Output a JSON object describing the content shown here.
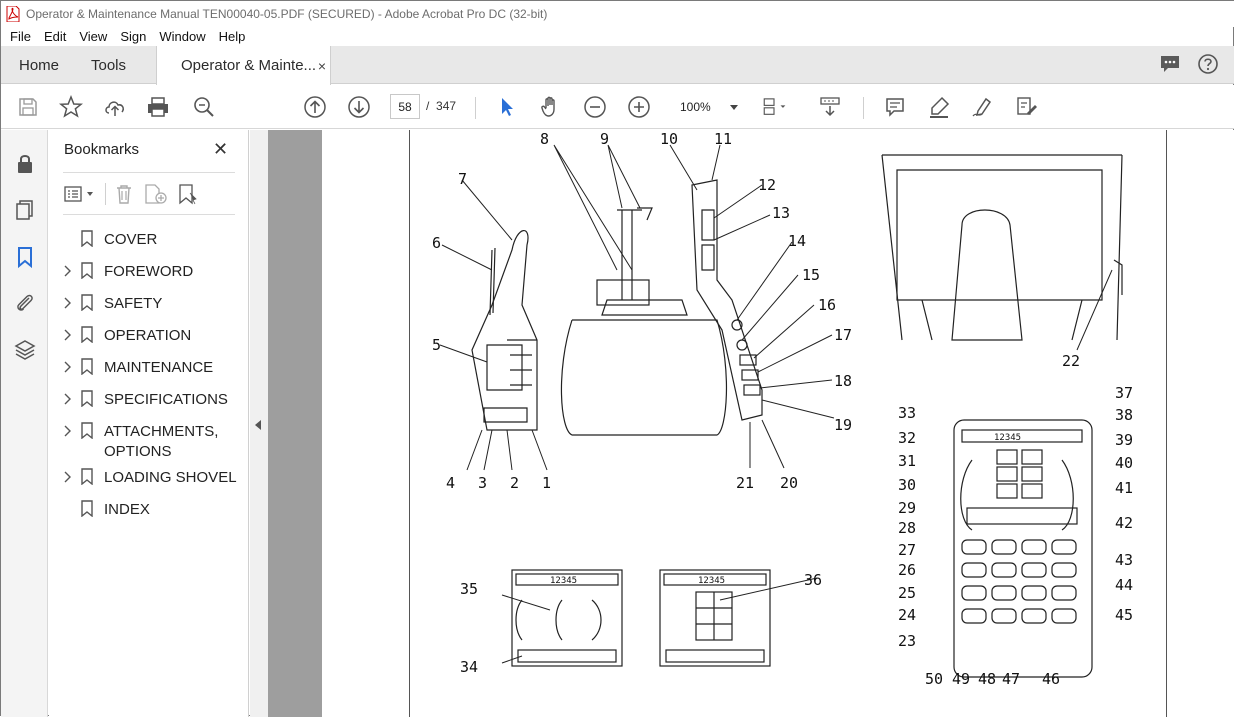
{
  "window": {
    "title": "Operator & Maintenance Manual TEN00040-05.PDF (SECURED) - Adobe Acrobat Pro DC (32-bit)"
  },
  "menu": [
    "File",
    "Edit",
    "View",
    "Sign",
    "Window",
    "Help"
  ],
  "tabs": {
    "home": "Home",
    "tools": "Tools",
    "document": "Operator & Mainte...",
    "close_glyph": "×"
  },
  "toolbar": {
    "page_current": "58",
    "page_sep": "/",
    "page_total": "347",
    "zoom": "100%"
  },
  "bookmarks": {
    "title": "Bookmarks",
    "close_glyph": "✕",
    "items": [
      {
        "label": "COVER",
        "expandable": false
      },
      {
        "label": "FOREWORD",
        "expandable": true
      },
      {
        "label": "SAFETY",
        "expandable": true
      },
      {
        "label": "OPERATION",
        "expandable": true
      },
      {
        "label": "MAINTENANCE",
        "expandable": true
      },
      {
        "label": "SPECIFICATIONS",
        "expandable": true
      },
      {
        "label": "ATTACHMENTS, OPTIONS",
        "expandable": true
      },
      {
        "label": "LOADING SHOVEL",
        "expandable": true
      },
      {
        "label": "INDEX",
        "expandable": false
      }
    ]
  },
  "figure": {
    "labels_top": [
      "8",
      "9",
      "10",
      "11",
      "12",
      "13",
      "14",
      "15",
      "16",
      "17",
      "18",
      "19",
      "20",
      "21",
      "7",
      "6",
      "5",
      "4",
      "3",
      "2",
      "1",
      "22"
    ],
    "labels_monitor": [
      "33",
      "32",
      "31",
      "30",
      "29",
      "28",
      "27",
      "26",
      "25",
      "24",
      "23",
      "37",
      "38",
      "39",
      "40",
      "41",
      "42",
      "43",
      "44",
      "45",
      "50",
      "49",
      "48",
      "47",
      "46"
    ],
    "labels_small": [
      "35",
      "34",
      "36"
    ],
    "odometer": "12345"
  }
}
